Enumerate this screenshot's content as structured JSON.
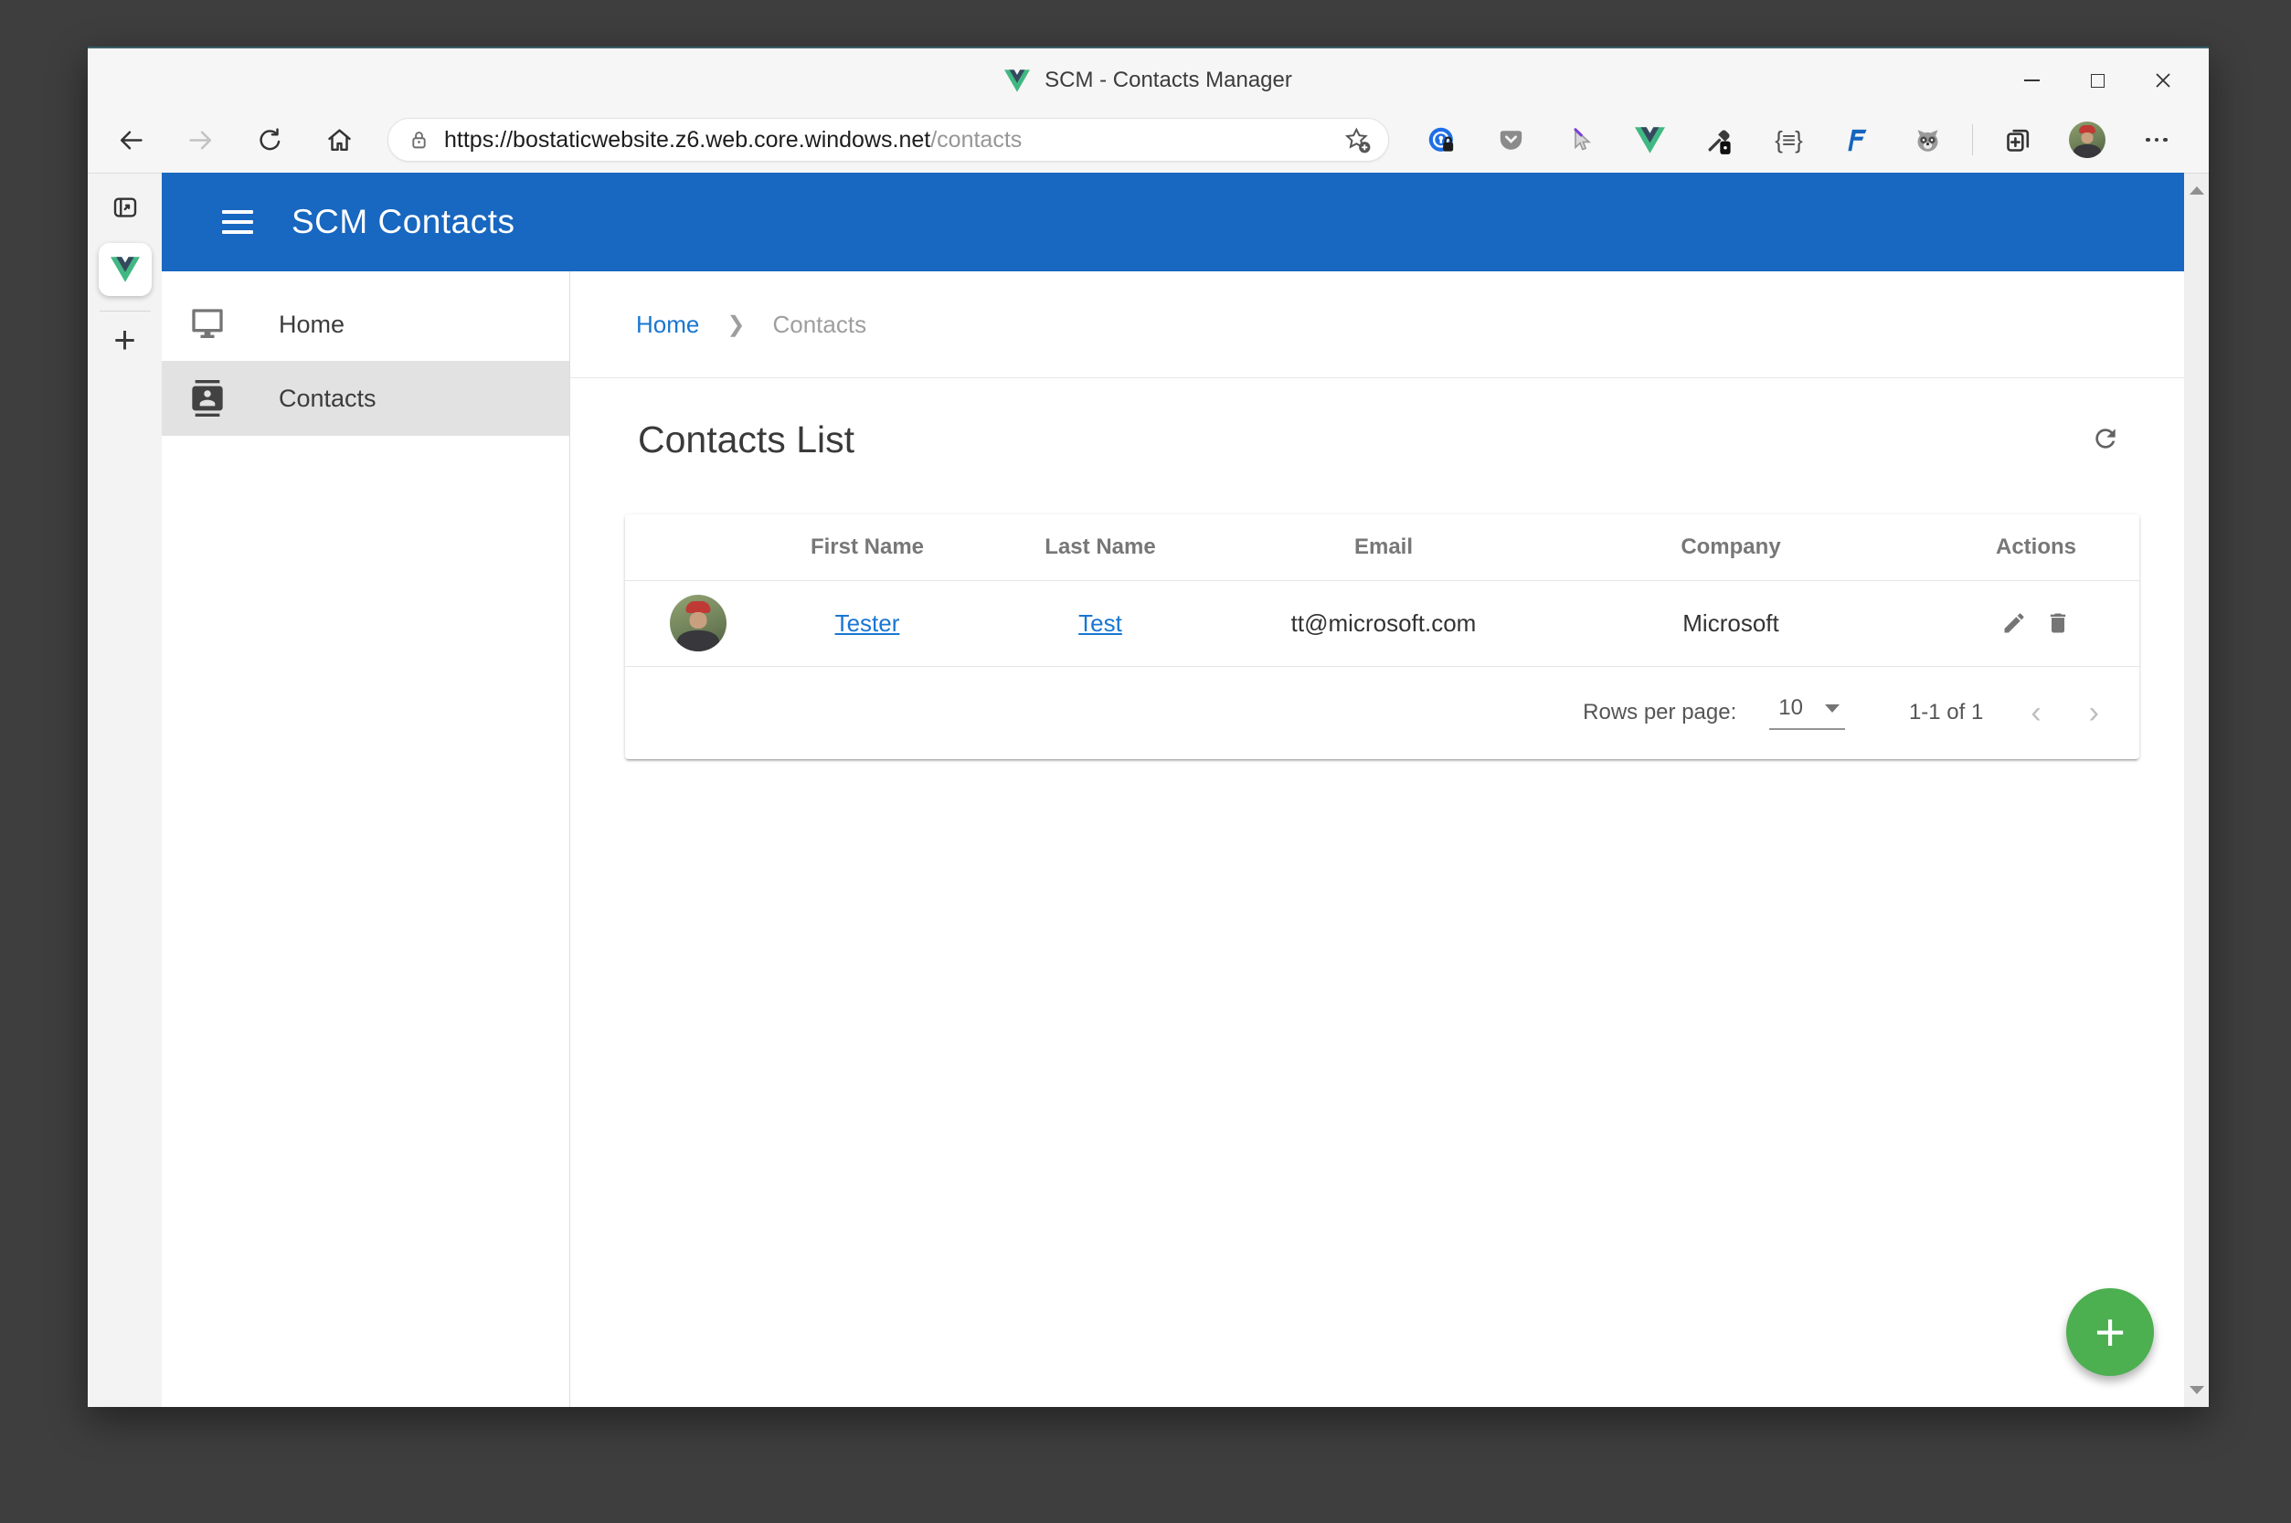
{
  "theme": {
    "primary": "#1867c0",
    "fab": "#4caf50",
    "link": "#1976d2",
    "active-nav": "#e2e2e2"
  },
  "browser": {
    "title_bar": {
      "title": "SCM - Contacts Manager"
    },
    "toolbar": {
      "url_host": "https://bostaticwebsite.z6.web.core.windows.net",
      "url_path": "/contacts",
      "extensions": {
        "json_glyph": "{≡}"
      }
    }
  },
  "app": {
    "header": {
      "title": "SCM Contacts"
    },
    "nav": {
      "items": [
        {
          "label": "Home"
        },
        {
          "label": "Contacts"
        }
      ]
    },
    "breadcrumb": {
      "items": [
        "Home",
        "Contacts"
      ],
      "separator": "❯"
    },
    "page": {
      "title": "Contacts List"
    },
    "table": {
      "columns": [
        "",
        "First Name",
        "Last Name",
        "Email",
        "Company",
        "Actions"
      ],
      "rows": [
        {
          "first_name": "Tester",
          "last_name": "Test",
          "email": "tt@microsoft.com",
          "company": "Microsoft"
        }
      ],
      "pagination": {
        "rows_per_page_label": "Rows per page:",
        "rows_per_page_value": "10",
        "range_label": "1-1 of 1"
      }
    },
    "fab": {
      "glyph": "+"
    }
  }
}
